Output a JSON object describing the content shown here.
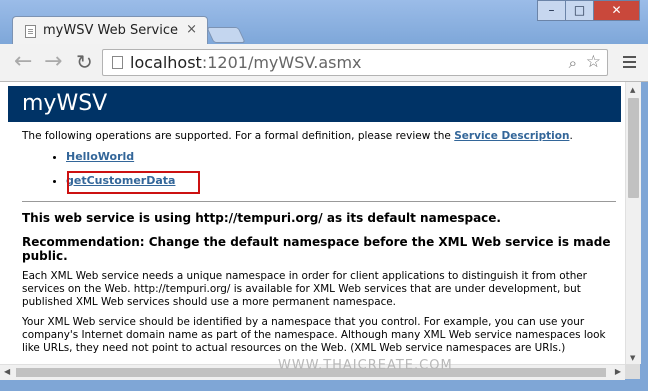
{
  "browser": {
    "tab_title": "myWSV Web Service",
    "tab_close": "×",
    "url_host": "localhost",
    "url_path": ":1201/myWSV.asmx",
    "window_buttons": [
      "–",
      "□",
      "✕"
    ]
  },
  "page": {
    "heading": "myWSV",
    "intro_text": "The following operations are supported. For a formal definition, please review the ",
    "service_description_link": "Service Description",
    "intro_end": ".",
    "operations": [
      "HelloWorld",
      "getCustomerData"
    ],
    "namespace_notice": "This web service is using http://tempuri.org/ as its default namespace.",
    "recommendation": "Recommendation: Change the default namespace before the XML Web service is made public.",
    "paragraph1": "Each XML Web service needs a unique namespace in order for client applications to distinguish it from other services on the Web. http://tempuri.org/ is available for XML Web services that are under development, but published XML Web services should use a more permanent namespace.",
    "paragraph2": "Your XML Web service should be identified by a namespace that you control. For example, you can use your company's Internet domain name as part of the namespace. Although many XML Web service namespaces look like URLs, they need not point to actual resources on the Web. (XML Web service namespaces are URIs.)"
  },
  "watermark": "WWW.THAICREATE.COM",
  "colors": {
    "heading_bg": "#003366",
    "link": "#336699",
    "highlight": "#cc1111"
  }
}
